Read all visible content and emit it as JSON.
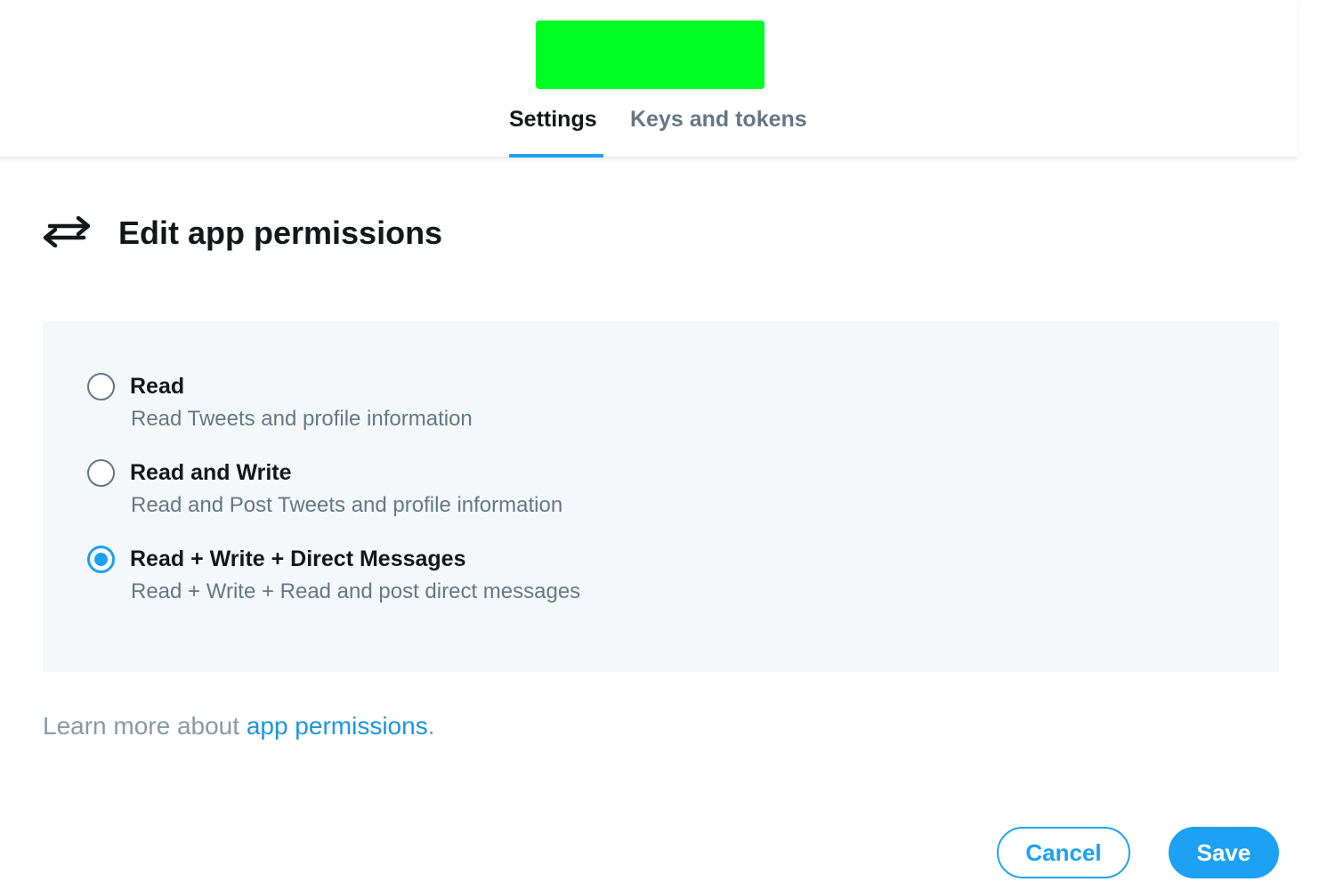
{
  "header": {
    "logo_color": "#00ff22",
    "tabs": [
      {
        "label": "Settings",
        "active": true
      },
      {
        "label": "Keys and tokens",
        "active": false
      }
    ]
  },
  "main": {
    "icon": "swap-arrows-icon",
    "title": "Edit app permissions",
    "options": [
      {
        "label": "Read",
        "description": "Read Tweets and profile information",
        "selected": false
      },
      {
        "label": "Read and Write",
        "description": "Read and Post Tweets and profile information",
        "selected": false
      },
      {
        "label": "Read + Write + Direct Messages",
        "description": "Read + Write + Read and post direct messages",
        "selected": true
      }
    ],
    "learn_more": {
      "prefix": "Learn more about ",
      "link_text": "app permissions",
      "suffix": "."
    }
  },
  "actions": {
    "cancel_label": "Cancel",
    "save_label": "Save"
  },
  "colors": {
    "accent": "#1da1f2",
    "panel_bg": "#f5f8fa",
    "muted_text": "#657786"
  }
}
